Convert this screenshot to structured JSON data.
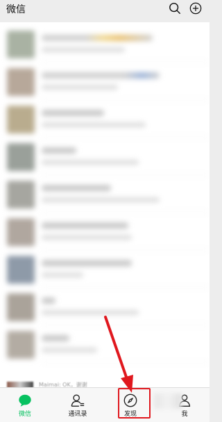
{
  "header": {
    "title": "微信",
    "icons": [
      "search-icon",
      "add-circle-icon"
    ]
  },
  "chat_list": {
    "peek_text": "Maimai: OK，谢谢"
  },
  "tabbar": {
    "tabs": [
      {
        "label": "微信",
        "icon": "chat-bubble-icon",
        "active": true
      },
      {
        "label": "通讯录",
        "icon": "contacts-icon",
        "active": false
      },
      {
        "label": "发现",
        "icon": "compass-icon",
        "active": false
      },
      {
        "label": "我",
        "icon": "person-icon",
        "active": false
      }
    ]
  },
  "annotation": {
    "highlight_color": "#e0181e",
    "target": "发现"
  },
  "colors": {
    "accent": "#07c160",
    "annotation_red": "#e0181e"
  }
}
